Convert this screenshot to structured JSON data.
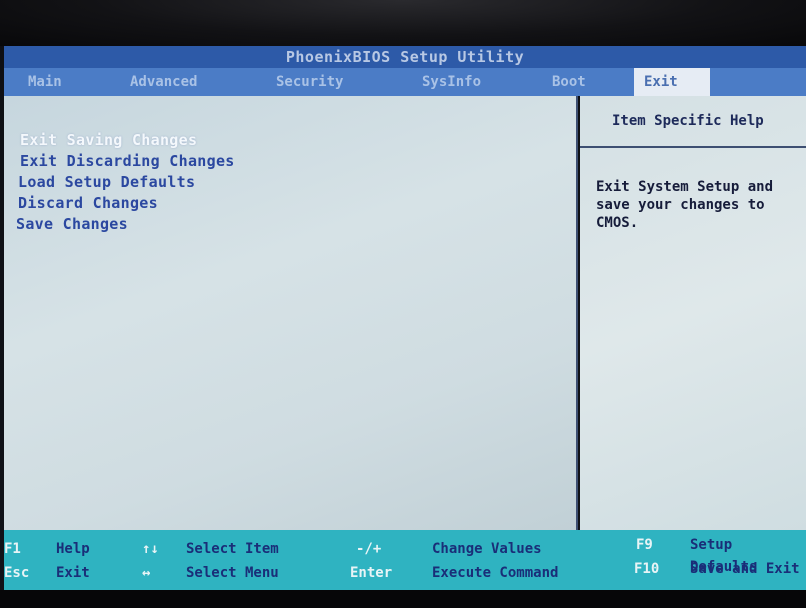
{
  "title": "PhoenixBIOS Setup Utility",
  "menu": [
    {
      "label": "Main",
      "active": false
    },
    {
      "label": "Advanced",
      "active": false
    },
    {
      "label": "Security",
      "active": false
    },
    {
      "label": "SysInfo",
      "active": false
    },
    {
      "label": "Boot",
      "active": false
    },
    {
      "label": "Exit",
      "active": true
    }
  ],
  "options": [
    {
      "label": "Exit Saving Changes",
      "selected": true
    },
    {
      "label": "Exit Discarding Changes",
      "selected": false
    },
    {
      "label": "Load Setup Defaults",
      "selected": false
    },
    {
      "label": "Discard Changes",
      "selected": false
    },
    {
      "label": "Save Changes",
      "selected": false
    }
  ],
  "help": {
    "title": "Item Specific Help",
    "text": "Exit System Setup and\nsave your changes to\nCMOS."
  },
  "footer": {
    "f1_key": "F1",
    "f1_desc": "Help",
    "esc_key": "Esc",
    "esc_desc": "Exit",
    "updown_key": "↑↓",
    "updown_desc": "Select Item",
    "leftright_key": "↔",
    "leftright_desc": "Select Menu",
    "minusplus_key": "-/+",
    "minusplus_desc": "Change Values",
    "enter_key": "Enter",
    "enter_desc": "Execute Command",
    "f9_key": "F9",
    "f9_desc": "Setup Defaults",
    "f10_key": "F10",
    "f10_desc": "Save and Exit"
  },
  "colors": {
    "title_bar": "#2d5aa8",
    "menu_bar": "#4b7cc6",
    "panel": "#d0dde2",
    "footer": "#2fb3c1",
    "option_text": "#2b48a0",
    "selected_text": "#f4f8fc"
  }
}
